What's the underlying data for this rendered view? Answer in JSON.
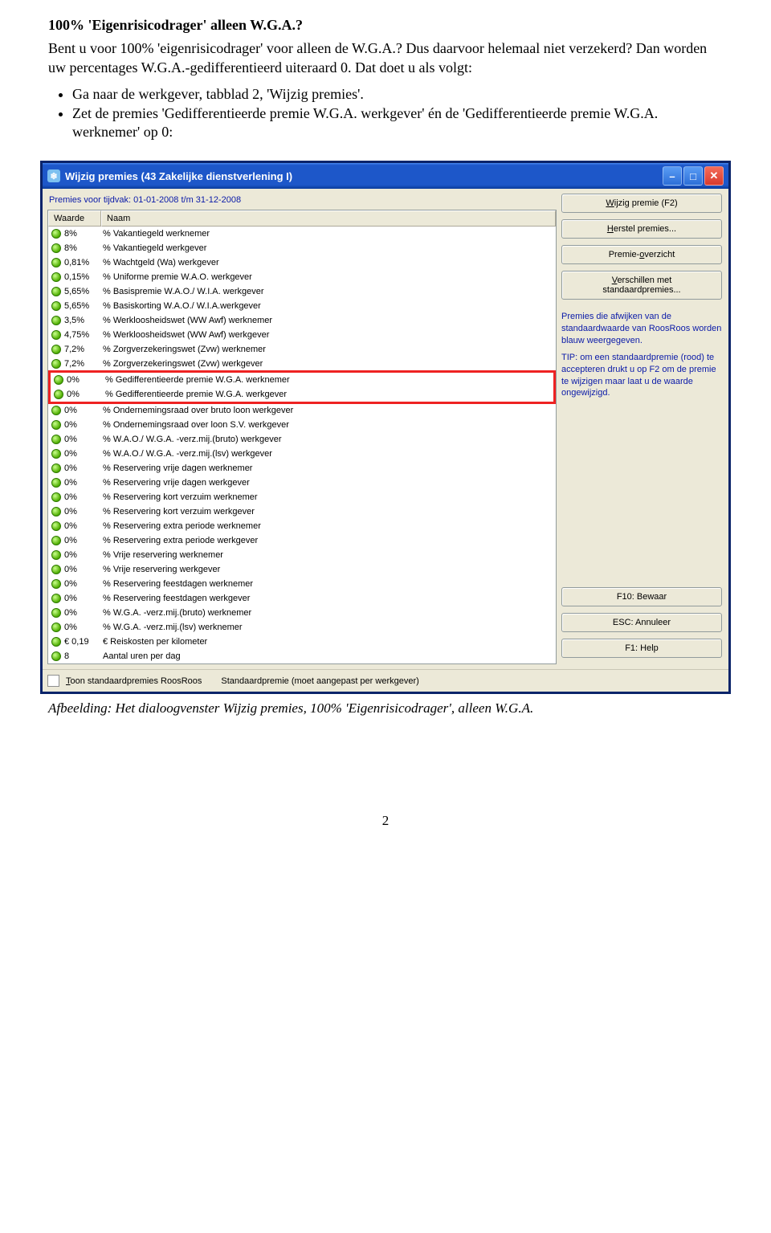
{
  "doc": {
    "heading": "100% 'Eigenrisicodrager' alleen W.G.A.?",
    "para1": "Bent u voor 100% 'eigenrisicodrager' voor alleen de W.G.A.? Dus daarvoor helemaal niet verzekerd? Dan worden uw percentages W.G.A.-gedifferentieerd uiteraard 0. Dat doet u als volgt:",
    "bullet1": "Ga naar de werkgever, tabblad 2, 'Wijzig premies'.",
    "bullet2": "Zet de premies 'Gedifferentieerde premie W.G.A. werkgever' én de 'Gedifferentieerde premie W.G.A. werknemer' op 0:",
    "caption": "Afbeelding: Het dialoogvenster Wijzig premies, 100% 'Eigenrisicodrager', alleen W.G.A.",
    "pagenum": "2"
  },
  "window": {
    "title": "Wijzig premies (43 Zakelijke dienstverlening I)",
    "period": "Premies voor tijdvak:  01-01-2008 t/m 31-12-2008",
    "col_waarde": "Waarde",
    "col_naam": "Naam",
    "buttons": {
      "wijzig": "Wijzig premie (F2)",
      "herstel": "Herstel premies...",
      "overzicht": "Premie-overzicht",
      "verschillen1": "Verschillen met",
      "verschillen2": "standaardpremies...",
      "bewaar": "F10: Bewaar",
      "annuleer": "ESC: Annuleer",
      "help": "F1: Help"
    },
    "info1": "Premies die afwijken van de standaardwaarde van RoosRoos worden blauw weergegeven.",
    "info2": "TIP: om een standaardpremie (rood) te accepteren drukt u op F2 om de premie te wijzigen maar laat u de waarde ongewijzigd.",
    "checkbox_label": "Toon standaardpremies RoosRoos",
    "legend": "Standaardpremie (moet aangepast per werkgever)"
  },
  "rows": [
    {
      "v": "8%",
      "n": "% Vakantiegeld werknemer"
    },
    {
      "v": "8%",
      "n": "% Vakantiegeld werkgever"
    },
    {
      "v": "0,81%",
      "n": "% Wachtgeld (Wa) werkgever"
    },
    {
      "v": "0,15%",
      "n": "% Uniforme premie W.A.O. werkgever"
    },
    {
      "v": "5,65%",
      "n": "% Basispremie W.A.O./ W.I.A. werkgever"
    },
    {
      "v": "5,65%",
      "n": "% Basiskorting W.A.O./ W.I.A.werkgever"
    },
    {
      "v": "3,5%",
      "n": "% Werkloosheidswet (WW Awf) werknemer"
    },
    {
      "v": "4,75%",
      "n": "% Werkloosheidswet (WW Awf) werkgever"
    },
    {
      "v": "7,2%",
      "n": "% Zorgverzekeringswet (Zvw) werknemer"
    },
    {
      "v": "7,2%",
      "n": "% Zorgverzekeringswet (Zvw) werkgever"
    },
    {
      "v": "0%",
      "n": "% Gedifferentieerde premie W.G.A. werknemer",
      "hi": true
    },
    {
      "v": "0%",
      "n": "% Gedifferentieerde premie W.G.A. werkgever",
      "hi": true
    },
    {
      "v": "0%",
      "n": "% Ondernemingsraad over bruto loon werkgever"
    },
    {
      "v": "0%",
      "n": "% Ondernemingsraad over loon S.V. werkgever"
    },
    {
      "v": "0%",
      "n": "% W.A.O./ W.G.A. -verz.mij.(bruto) werkgever"
    },
    {
      "v": "0%",
      "n": "% W.A.O./ W.G.A. -verz.mij.(lsv) werkgever"
    },
    {
      "v": "0%",
      "n": "% Reservering vrije dagen werknemer"
    },
    {
      "v": "0%",
      "n": "% Reservering vrije dagen werkgever"
    },
    {
      "v": "0%",
      "n": "% Reservering kort verzuim werknemer"
    },
    {
      "v": "0%",
      "n": "% Reservering kort verzuim werkgever"
    },
    {
      "v": "0%",
      "n": "% Reservering extra periode werknemer"
    },
    {
      "v": "0%",
      "n": "% Reservering extra periode werkgever"
    },
    {
      "v": "0%",
      "n": "% Vrije reservering werknemer"
    },
    {
      "v": "0%",
      "n": "% Vrije reservering werkgever"
    },
    {
      "v": "0%",
      "n": "% Reservering feestdagen werknemer"
    },
    {
      "v": "0%",
      "n": "% Reservering feestdagen werkgever"
    },
    {
      "v": "0%",
      "n": "% W.G.A. -verz.mij.(bruto) werknemer"
    },
    {
      "v": "0%",
      "n": "% W.G.A. -verz.mij.(lsv) werknemer"
    },
    {
      "v": "€ 0,19",
      "n": "€ Reiskosten per kilometer"
    },
    {
      "v": "8",
      "n": "Aantal uren per dag"
    }
  ]
}
